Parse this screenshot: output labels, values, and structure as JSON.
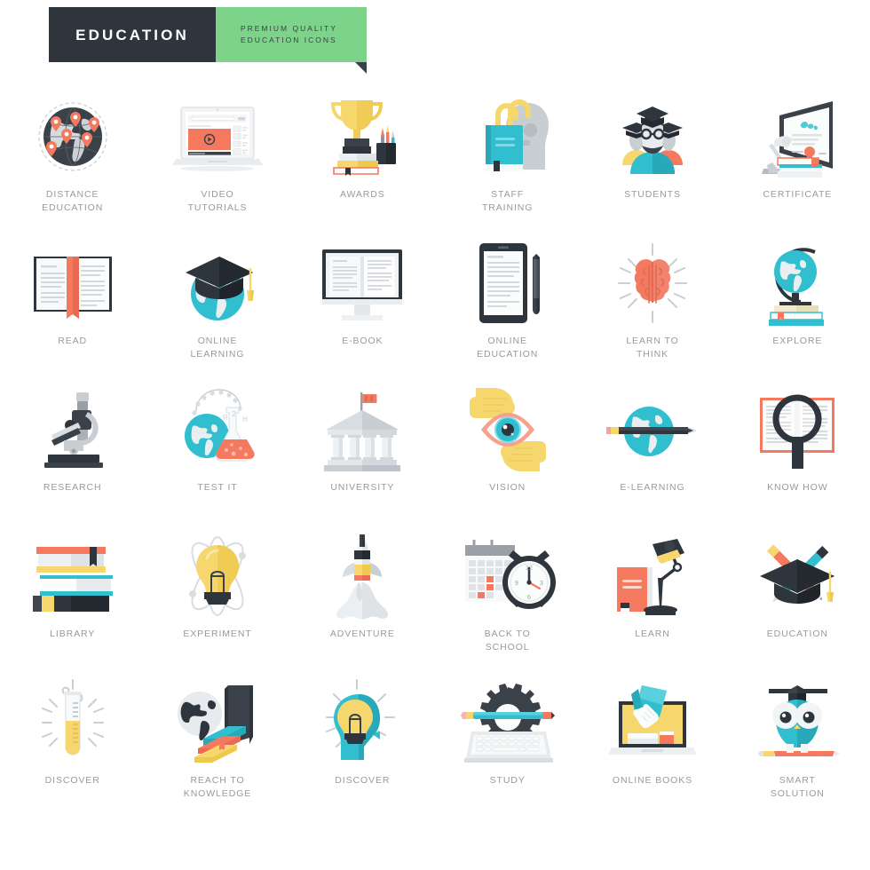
{
  "header": {
    "brand": "EDUCATION",
    "tagline_line1": "PREMIUM QUALITY",
    "tagline_line2": "EDUCATION ICONS",
    "dark_color": "#2e353c",
    "green_color": "#7dd389",
    "brand_text_color": "#ffffff",
    "tagline_text_color": "#3a4048"
  },
  "palette": {
    "label_gray": "#9a9a9a",
    "teal": "#31bfd0",
    "coral": "#f4795f",
    "yellow": "#f5d76e",
    "dark": "#2e353c",
    "light_gray": "#d8dde1",
    "background": "#ffffff"
  },
  "grid": {
    "columns": 6,
    "rows": 5,
    "total_icons": 30
  },
  "icons": [
    {
      "id": "distance-education",
      "label": "DISTANCE\nEDUCATION",
      "row": 1,
      "col": 1
    },
    {
      "id": "video-tutorials",
      "label": "VIDEO\nTUTORIALS",
      "row": 1,
      "col": 2
    },
    {
      "id": "awards",
      "label": "AWARDS",
      "row": 1,
      "col": 3
    },
    {
      "id": "staff-training",
      "label": "STAFF\nTRAINING",
      "row": 1,
      "col": 4
    },
    {
      "id": "students",
      "label": "STUDENTS",
      "row": 1,
      "col": 5
    },
    {
      "id": "certificate",
      "label": "CERTIFICATE",
      "row": 1,
      "col": 6
    },
    {
      "id": "read",
      "label": "READ",
      "row": 2,
      "col": 1
    },
    {
      "id": "online-learning",
      "label": "ONLINE\nLEARNING",
      "row": 2,
      "col": 2
    },
    {
      "id": "e-book",
      "label": "E-BOOK",
      "row": 2,
      "col": 3
    },
    {
      "id": "online-education",
      "label": "ONLINE\nEDUCATION",
      "row": 2,
      "col": 4
    },
    {
      "id": "learn-to-think",
      "label": "LEARN TO\nTHINK",
      "row": 2,
      "col": 5
    },
    {
      "id": "explore",
      "label": "EXPLORE",
      "row": 2,
      "col": 6
    },
    {
      "id": "research",
      "label": "RESEARCH",
      "row": 3,
      "col": 1
    },
    {
      "id": "test-it",
      "label": "TEST IT",
      "row": 3,
      "col": 2
    },
    {
      "id": "university",
      "label": "UNIVERSITY",
      "row": 3,
      "col": 3
    },
    {
      "id": "vision",
      "label": "VISION",
      "row": 3,
      "col": 4
    },
    {
      "id": "e-learning",
      "label": "E-LEARNING",
      "row": 3,
      "col": 5
    },
    {
      "id": "know-how",
      "label": "KNOW HOW",
      "row": 3,
      "col": 6
    },
    {
      "id": "library",
      "label": "LIBRARY",
      "row": 4,
      "col": 1
    },
    {
      "id": "experiment",
      "label": "EXPERIMENT",
      "row": 4,
      "col": 2
    },
    {
      "id": "adventure",
      "label": "ADVENTURE",
      "row": 4,
      "col": 3
    },
    {
      "id": "back-to-school",
      "label": "BACK TO\nSCHOOL",
      "row": 4,
      "col": 4
    },
    {
      "id": "learn",
      "label": "LEARN",
      "row": 4,
      "col": 5
    },
    {
      "id": "education",
      "label": "EDUCATION",
      "row": 4,
      "col": 6
    },
    {
      "id": "discover-testtube",
      "label": "DISCOVER",
      "row": 5,
      "col": 1
    },
    {
      "id": "reach-to-knowledge",
      "label": "REACH TO\nKNOWLEDGE",
      "row": 5,
      "col": 2
    },
    {
      "id": "discover-head",
      "label": "DISCOVER",
      "row": 5,
      "col": 3
    },
    {
      "id": "study",
      "label": "STUDY",
      "row": 5,
      "col": 4
    },
    {
      "id": "online-books",
      "label": "ONLINE BOOKS",
      "row": 5,
      "col": 5
    },
    {
      "id": "smart-solution",
      "label": "SMART\nSOLUTION",
      "row": 5,
      "col": 6
    }
  ]
}
